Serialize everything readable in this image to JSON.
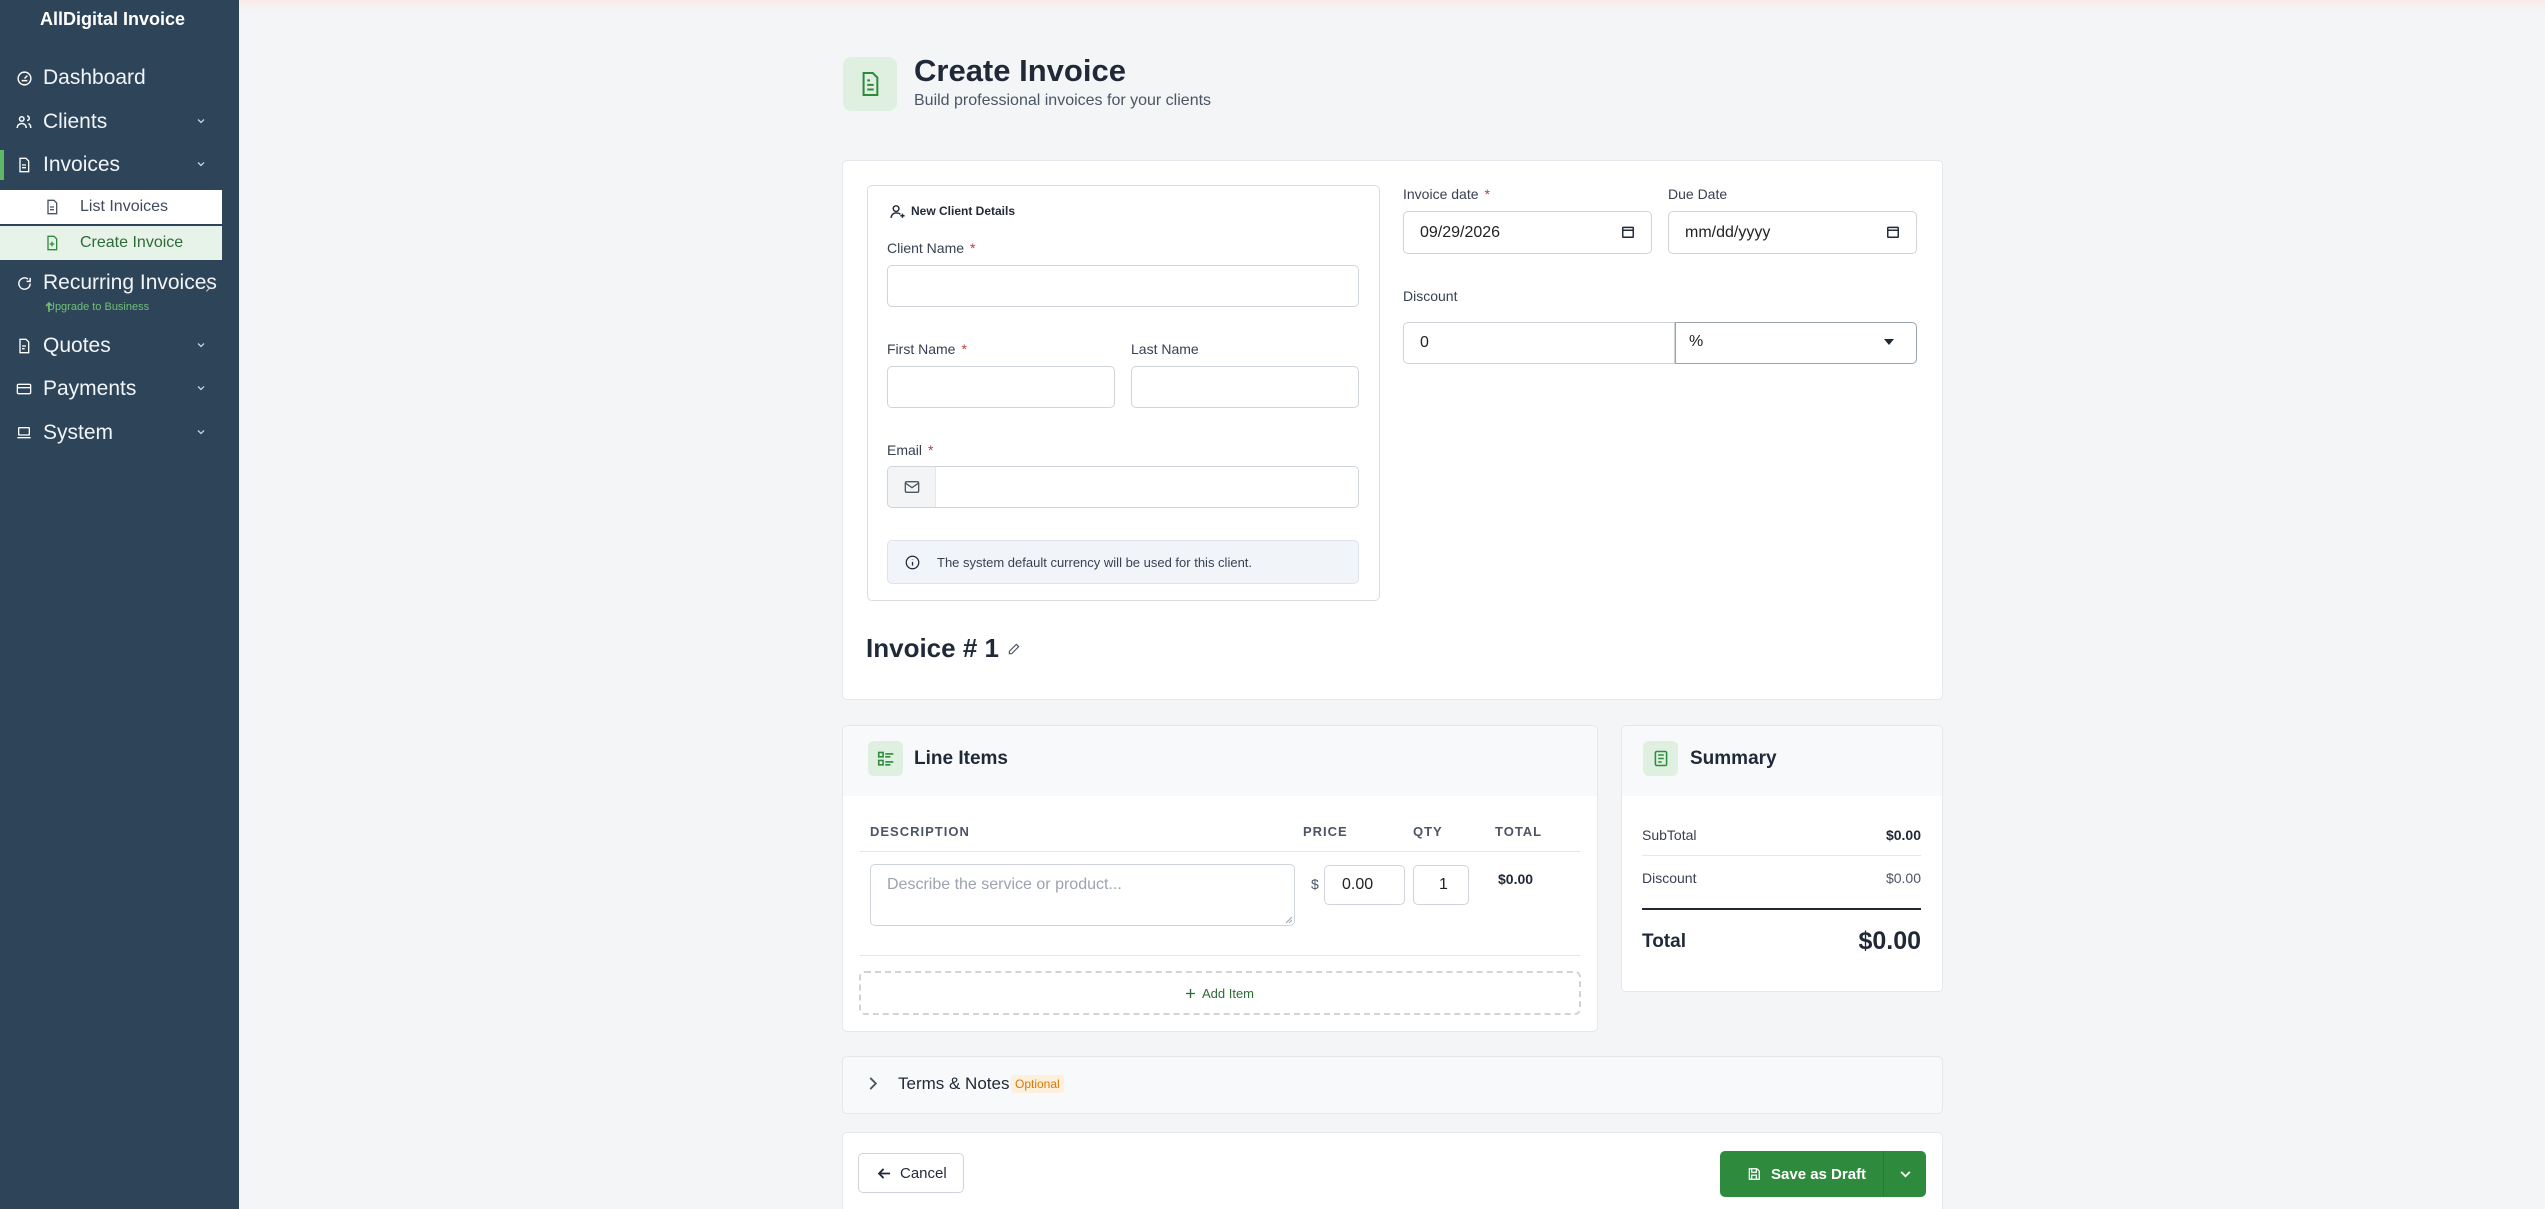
{
  "app": {
    "brand": "AllDigital Invoice"
  },
  "sidebar": {
    "items": [
      {
        "label": "Dashboard",
        "icon": "dashboard-icon"
      },
      {
        "label": "Clients",
        "icon": "clients-icon"
      },
      {
        "label": "Invoices",
        "icon": "invoice-icon"
      },
      {
        "label": "Recurring Invoices",
        "icon": "recurring-icon"
      },
      {
        "label": "Quotes",
        "icon": "quote-icon"
      },
      {
        "label": "Payments",
        "icon": "payments-icon"
      },
      {
        "label": "System",
        "icon": "system-icon"
      }
    ],
    "sub_items": [
      {
        "label": "List Invoices"
      },
      {
        "label": "Create Invoice"
      }
    ],
    "upgrade_note": "Upgrade to Business"
  },
  "header": {
    "title": "Create Invoice",
    "subtitle": "Build professional invoices for your clients"
  },
  "client_form": {
    "section_title": "New Client Details",
    "client_name_label": "Client Name",
    "first_name_label": "First Name",
    "last_name_label": "Last Name",
    "email_label": "Email",
    "required_mark": "*",
    "currency_note": "The system default currency will be used for this client."
  },
  "invoice_meta": {
    "invoice_date_label": "Invoice date",
    "invoice_date_value": "09/29/2026",
    "due_date_label": "Due Date",
    "due_date_placeholder": "mm/dd/yyyy",
    "discount_label": "Discount",
    "discount_value": "0",
    "discount_type": "%",
    "invoice_number": "Invoice # 1"
  },
  "line_items": {
    "title": "Line Items",
    "columns": [
      "DESCRIPTION",
      "PRICE",
      "QTY",
      "TOTAL"
    ],
    "rows": [
      {
        "description_placeholder": "Describe the service or product...",
        "currency": "$",
        "price": "0.00",
        "qty": "1",
        "total": "$0.00"
      }
    ],
    "add_label": "Add Item"
  },
  "summary": {
    "title": "Summary",
    "subtotal_label": "SubTotal",
    "subtotal_value": "$0.00",
    "discount_label": "Discount",
    "discount_value": "$0.00",
    "total_label": "Total",
    "total_value": "$0.00"
  },
  "terms": {
    "label": "Terms & Notes",
    "badge": "Optional"
  },
  "actions": {
    "cancel_label": "Cancel",
    "save_label": "Save as Draft"
  },
  "colors": {
    "sidebar": "#2e4459",
    "accent": "#2e8b3e",
    "accent_light": "#e7f3e8"
  }
}
